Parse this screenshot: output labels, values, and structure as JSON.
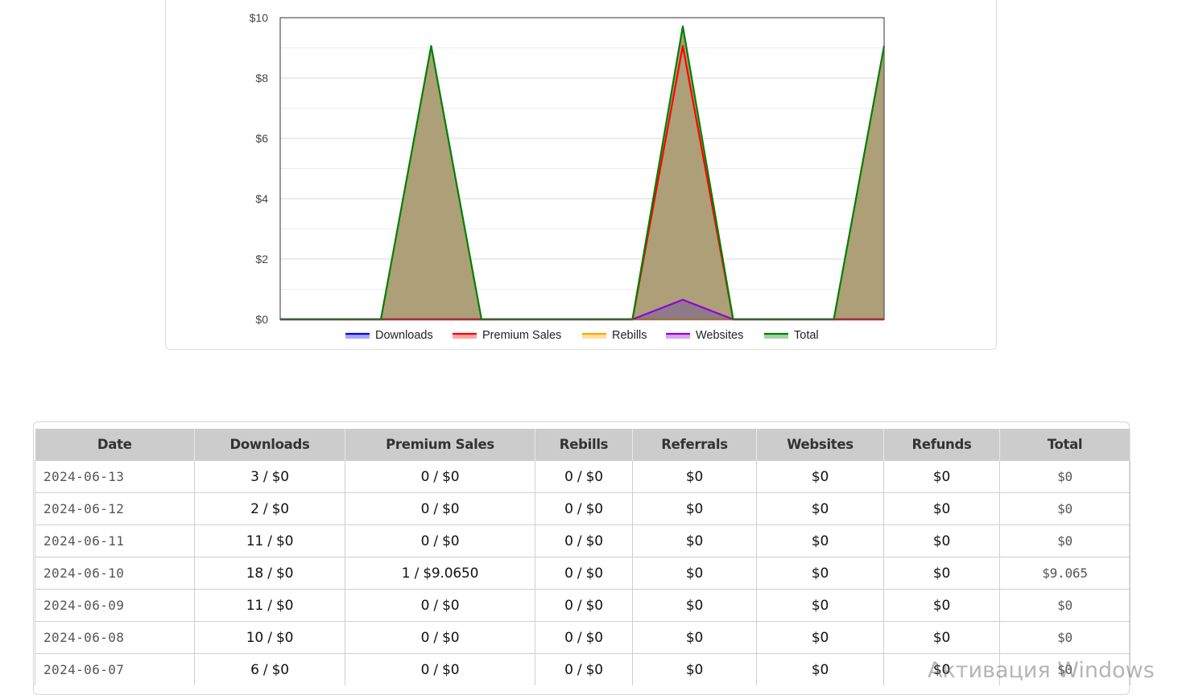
{
  "chart_data": {
    "type": "area",
    "y_ticks": [
      "$0",
      "$2",
      "$4",
      "$6",
      "$8",
      "$10"
    ],
    "ylim": [
      0,
      10
    ],
    "grid": true,
    "legend_position": "bottom",
    "x": [
      0,
      1,
      2,
      3,
      4,
      5,
      6,
      7,
      8,
      9,
      10,
      11,
      12
    ],
    "series": [
      {
        "name": "Downloads",
        "color": "#0000ff",
        "values": [
          0,
          0,
          0,
          0,
          0,
          0,
          0,
          0,
          0,
          0,
          0,
          0,
          0
        ]
      },
      {
        "name": "Premium Sales",
        "color": "#ff0000",
        "values": [
          0,
          0,
          0,
          0,
          0,
          0,
          0,
          0,
          9.065,
          0,
          0,
          0,
          0
        ]
      },
      {
        "name": "Rebills",
        "color": "#ffa500",
        "values": [
          0,
          0,
          0,
          0,
          0,
          0,
          0,
          0,
          0,
          0,
          0,
          0,
          0
        ]
      },
      {
        "name": "Websites",
        "color": "#9400d3",
        "values": [
          0,
          0,
          0,
          0,
          0,
          0,
          0,
          0,
          0.65,
          0,
          0,
          0,
          0
        ]
      },
      {
        "name": "Total",
        "color": "#008000",
        "values": [
          0,
          0,
          0,
          9.065,
          0,
          0,
          0,
          0,
          9.715,
          0,
          0,
          0,
          9.065
        ]
      }
    ]
  },
  "table": {
    "headers": [
      "Date",
      "Downloads",
      "Premium Sales",
      "Rebills",
      "Referrals",
      "Websites",
      "Refunds",
      "Total"
    ],
    "rows": [
      [
        "2024-06-13",
        "3 / $0",
        "0 / $0",
        "0 / $0",
        "$0",
        "$0",
        "$0",
        "$0"
      ],
      [
        "2024-06-12",
        "2 / $0",
        "0 / $0",
        "0 / $0",
        "$0",
        "$0",
        "$0",
        "$0"
      ],
      [
        "2024-06-11",
        "11 / $0",
        "0 / $0",
        "0 / $0",
        "$0",
        "$0",
        "$0",
        "$0"
      ],
      [
        "2024-06-10",
        "18 / $0",
        "1 / $9.0650",
        "0 / $0",
        "$0",
        "$0",
        "$0",
        "$9.065"
      ],
      [
        "2024-06-09",
        "11 / $0",
        "0 / $0",
        "0 / $0",
        "$0",
        "$0",
        "$0",
        "$0"
      ],
      [
        "2024-06-08",
        "10 / $0",
        "0 / $0",
        "0 / $0",
        "$0",
        "$0",
        "$0",
        "$0"
      ],
      [
        "2024-06-07",
        "6 / $0",
        "0 / $0",
        "0 / $0",
        "$0",
        "$0",
        "$0",
        "$0"
      ]
    ]
  },
  "watermark": "Активация Windows"
}
